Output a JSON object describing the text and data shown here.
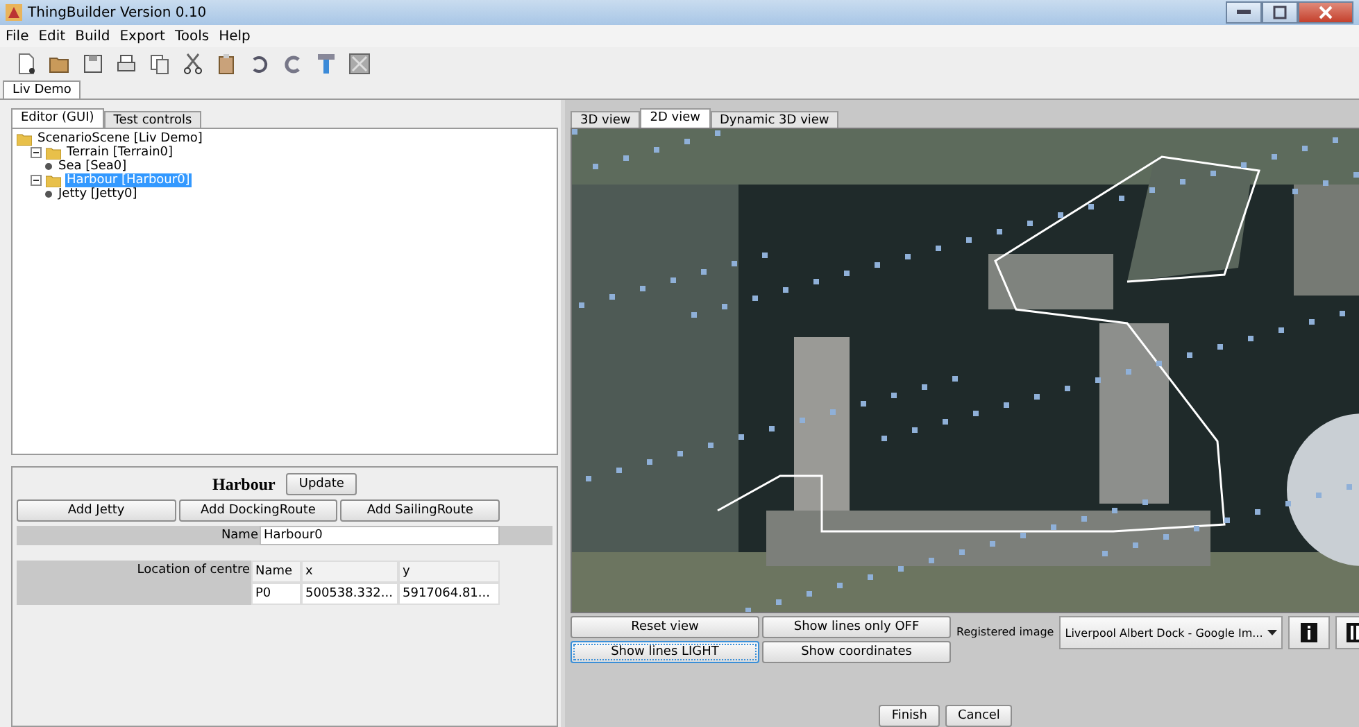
{
  "window": {
    "title": "ThingBuilder Version 0.10"
  },
  "menu": [
    "File",
    "Edit",
    "Build",
    "Export",
    "Tools",
    "Help"
  ],
  "document_tabs": [
    {
      "label": "Liv Demo",
      "selected": true
    }
  ],
  "left_tabs": [
    {
      "label": "Editor (GUI)",
      "selected": true
    },
    {
      "label": "Test controls",
      "selected": false
    }
  ],
  "tree": [
    {
      "label": "ScenarioScene [Liv Demo]",
      "kind": "folder",
      "selected": false,
      "children": [
        {
          "label": "Terrain [Terrain0]",
          "kind": "folder",
          "selected": false,
          "expanded": true,
          "children": [
            {
              "label": "Sea [Sea0]",
              "kind": "leaf",
              "selected": false
            }
          ]
        },
        {
          "label": "Harbour [Harbour0]",
          "kind": "folder",
          "selected": true,
          "expanded": true,
          "children": [
            {
              "label": "Jetty [Jetty0]",
              "kind": "leaf",
              "selected": false
            }
          ]
        }
      ]
    }
  ],
  "editor": {
    "heading": "Harbour",
    "update_button": "Update",
    "add_buttons": [
      "Add Jetty",
      "Add DockingRoute",
      "Add SailingRoute"
    ],
    "name_label": "Name",
    "name_value": "Harbour0",
    "location_label": "Location of centre",
    "location_table": {
      "columns": [
        "Name",
        "x",
        "y"
      ],
      "rows": [
        [
          "P0",
          "500538.332...",
          "5917064.81..."
        ]
      ]
    }
  },
  "view_tabs": [
    {
      "label": "3D view",
      "selected": false
    },
    {
      "label": "2D view",
      "selected": true
    },
    {
      "label": "Dynamic 3D view",
      "selected": false
    }
  ],
  "map": {
    "kind": "picture"
  },
  "view_buttons": [
    {
      "label": "Reset view",
      "focused": false
    },
    {
      "label": "Show lines only OFF",
      "focused": false
    },
    {
      "label": "Show lines LIGHT",
      "focused": true
    },
    {
      "label": "Show coordinates",
      "focused": false
    }
  ],
  "registered_image": {
    "label": "Registered image",
    "value": "Liverpool Albert Dock - Google Im..."
  },
  "dialog_buttons": [
    "Finish",
    "Cancel"
  ]
}
